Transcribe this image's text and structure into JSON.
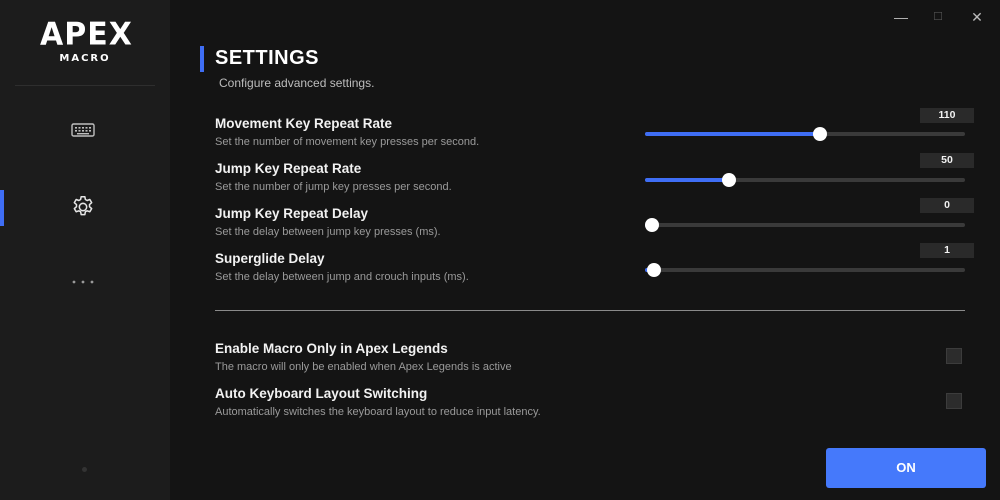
{
  "sidebar": {
    "logo_text": "APEX",
    "logo_sub": "MACRO",
    "items": [
      {
        "icon": "keyboard-icon"
      },
      {
        "icon": "gear-icon",
        "active": true
      },
      {
        "icon": "more-horizontal-icon"
      }
    ]
  },
  "window_controls": {
    "minimize": "—",
    "maximize": "☐",
    "close": "✕"
  },
  "header": {
    "title": "SETTINGS",
    "subtitle": "Configure advanced settings."
  },
  "sliders": [
    {
      "title": "Movement Key Repeat Rate",
      "description": "Set the number of movement key presses per second.",
      "value": "110",
      "fraction": 0.55
    },
    {
      "title": "Jump Key Repeat Rate",
      "description": "Set the number of jump key presses per second.",
      "value": "50",
      "fraction": 0.25
    },
    {
      "title": "Jump Key Repeat Delay",
      "description": "Set the delay between jump key presses (ms).",
      "value": "0",
      "fraction": 0.0
    },
    {
      "title": "Superglide Delay",
      "description": "Set the delay between jump and crouch inputs (ms).",
      "value": "1",
      "fraction": 0.006
    }
  ],
  "toggles": [
    {
      "title": "Enable Macro Only in Apex Legends",
      "description": "The macro will only be enabled when Apex Legends is active",
      "checked": false
    },
    {
      "title": "Auto Keyboard Layout Switching",
      "description": "Automatically switches the keyboard layout to reduce input latency.",
      "checked": false
    }
  ],
  "on_button": {
    "label": "ON"
  },
  "colors": {
    "accent": "#3f6ef5",
    "button": "#4579fb",
    "background": "#141414",
    "sidebar": "#1c1c1c"
  }
}
